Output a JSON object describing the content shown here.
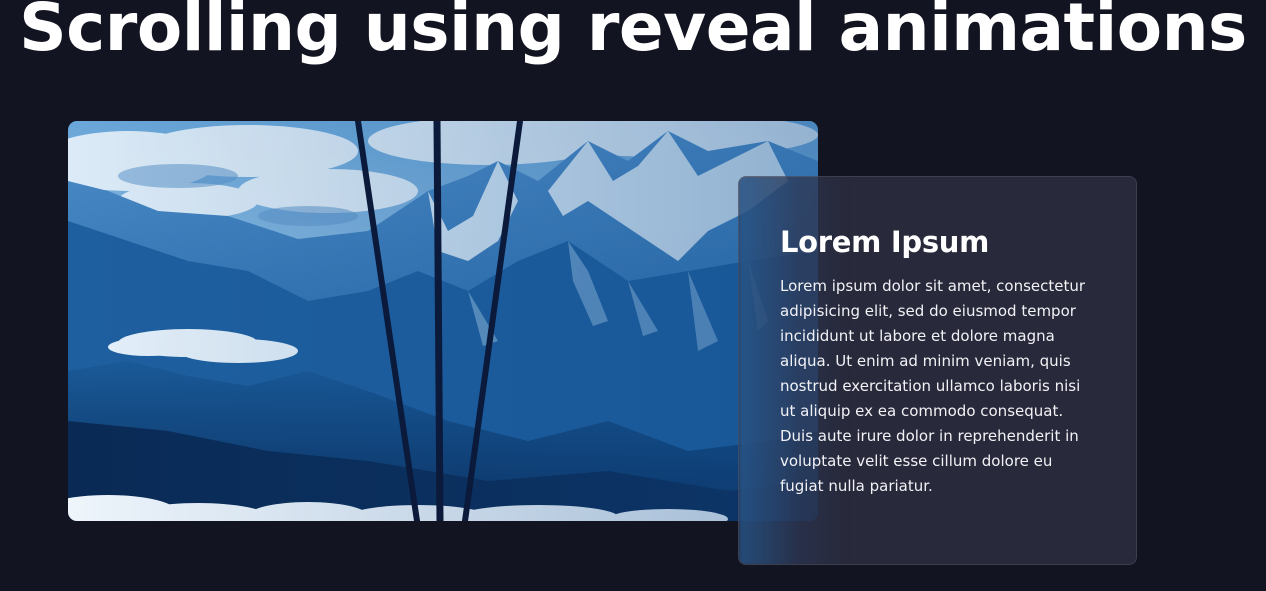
{
  "page": {
    "title": "Scrolling using reveal animations"
  },
  "hero_image": {
    "description_icon": "mountain-photo",
    "colors": {
      "sky": "#9cc6e8",
      "mountain": "#1c5c9e",
      "snow": "#d9ecf8",
      "cable": "#0b1a3a"
    }
  },
  "card": {
    "title": "Lorem Ipsum",
    "body": "Lorem ipsum dolor sit amet, consectetur adipisicing elit, sed do eiusmod tempor incididunt ut labore et dolore magna aliqua. Ut enim ad minim veniam, quis nostrud exercitation ullamco laboris nisi ut aliquip ex ea commodo consequat. Duis aute irure dolor in reprehenderit in voluptate velit esse cillum dolore eu fugiat nulla pariatur."
  },
  "theme": {
    "background": "#131422",
    "card_background": "#303244",
    "text": "#ffffff"
  }
}
